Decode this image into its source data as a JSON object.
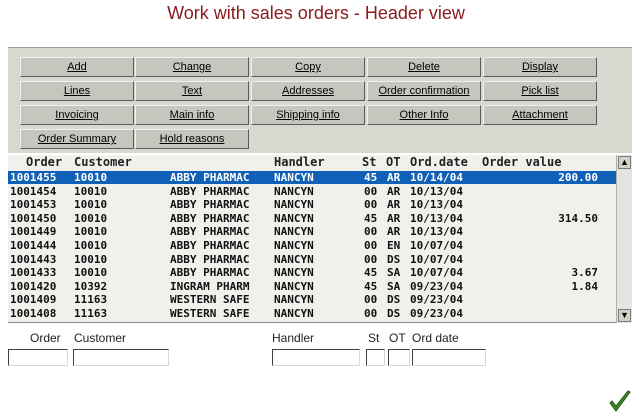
{
  "window": {
    "title": "Work with sales orders - Header view"
  },
  "toolbar": {
    "row1": [
      "Add",
      "Change",
      "Copy",
      "Delete",
      "Display"
    ],
    "row2": [
      "Lines",
      "Text",
      "Addresses",
      "Order confirmation",
      "Pick list"
    ],
    "row3": [
      "Invoicing",
      "Main info",
      "Shipping info",
      "Other Info",
      "Attachment"
    ],
    "row4": [
      "Order Summary",
      "Hold reasons"
    ]
  },
  "grid": {
    "headers": [
      "Order",
      "Customer",
      "Handler",
      "St",
      "OT",
      "Ord.date",
      "Order value"
    ],
    "rows": [
      {
        "order": "1001455",
        "customer_no": "10010",
        "customer_name": "ABBY PHARMAC",
        "handler": "NANCYN",
        "st": "45",
        "ot": "AR",
        "date": "10/14/04",
        "value": "200.00"
      },
      {
        "order": "1001454",
        "customer_no": "10010",
        "customer_name": "ABBY PHARMAC",
        "handler": "NANCYN",
        "st": "00",
        "ot": "AR",
        "date": "10/13/04",
        "value": ""
      },
      {
        "order": "1001453",
        "customer_no": "10010",
        "customer_name": "ABBY PHARMAC",
        "handler": "NANCYN",
        "st": "00",
        "ot": "AR",
        "date": "10/13/04",
        "value": ""
      },
      {
        "order": "1001450",
        "customer_no": "10010",
        "customer_name": "ABBY PHARMAC",
        "handler": "NANCYN",
        "st": "45",
        "ot": "AR",
        "date": "10/13/04",
        "value": "314.50"
      },
      {
        "order": "1001449",
        "customer_no": "10010",
        "customer_name": "ABBY PHARMAC",
        "handler": "NANCYN",
        "st": "00",
        "ot": "AR",
        "date": "10/13/04",
        "value": ""
      },
      {
        "order": "1001444",
        "customer_no": "10010",
        "customer_name": "ABBY PHARMAC",
        "handler": "NANCYN",
        "st": "00",
        "ot": "EN",
        "date": "10/07/04",
        "value": ""
      },
      {
        "order": "1001443",
        "customer_no": "10010",
        "customer_name": "ABBY PHARMAC",
        "handler": "NANCYN",
        "st": "00",
        "ot": "DS",
        "date": "10/07/04",
        "value": ""
      },
      {
        "order": "1001433",
        "customer_no": "10010",
        "customer_name": "ABBY PHARMAC",
        "handler": "NANCYN",
        "st": "45",
        "ot": "SA",
        "date": "10/07/04",
        "value": "3.67"
      },
      {
        "order": "1001420",
        "customer_no": "10392",
        "customer_name": "INGRAM PHARM",
        "handler": "NANCYN",
        "st": "45",
        "ot": "SA",
        "date": "09/23/04",
        "value": "1.84"
      },
      {
        "order": "1001409",
        "customer_no": "11163",
        "customer_name": "WESTERN SAFE",
        "handler": "NANCYN",
        "st": "00",
        "ot": "DS",
        "date": "09/23/04",
        "value": ""
      },
      {
        "order": "1001408",
        "customer_no": "11163",
        "customer_name": "WESTERN SAFE",
        "handler": "NANCYN",
        "st": "00",
        "ot": "DS",
        "date": "09/23/04",
        "value": ""
      }
    ],
    "selected_index": 0
  },
  "filters": {
    "order_label": "Order",
    "customer_label": "Customer",
    "handler_label": "Handler",
    "st_label": "St",
    "ot_label": "OT",
    "orddate_label": "Ord date",
    "order_value": "",
    "customer_value": "",
    "handler_value": "",
    "st_value": "",
    "ot_value": "",
    "orddate_value": ""
  },
  "icons": {
    "confirm": "checkmark-icon",
    "scroll_up": "scroll-up-icon",
    "scroll_down": "scroll-down-icon"
  },
  "colors": {
    "title": "#8b1a1a",
    "selected_row": "#1060b8",
    "confirm": "#3c8c28"
  }
}
